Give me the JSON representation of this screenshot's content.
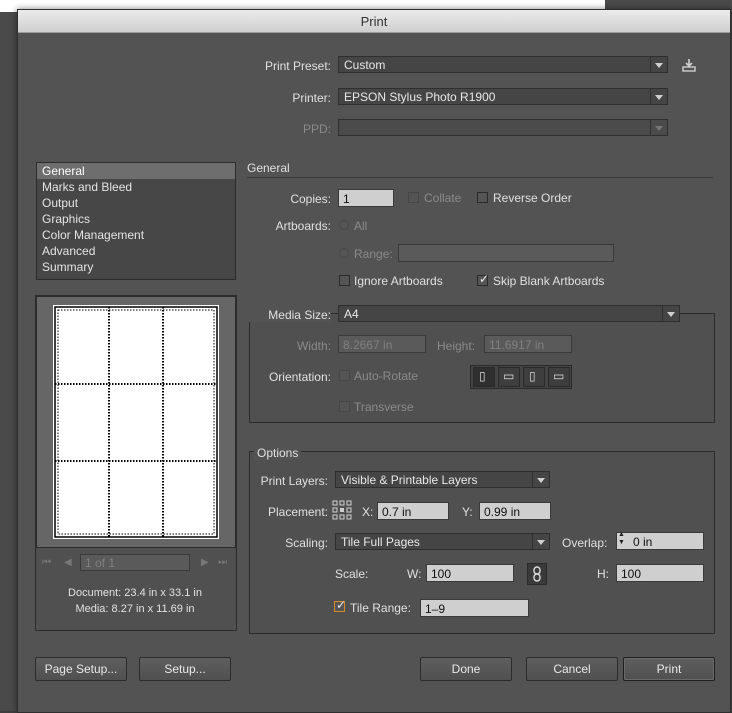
{
  "window": {
    "title": "Print"
  },
  "top": {
    "preset_label": "Print Preset:",
    "preset_value": "Custom",
    "printer_label": "Printer:",
    "printer_value": "EPSON Stylus Photo R1900",
    "ppd_label": "PPD:",
    "ppd_value": ""
  },
  "sidebar": {
    "items": [
      {
        "label": "General",
        "selected": true
      },
      {
        "label": "Marks and Bleed"
      },
      {
        "label": "Output"
      },
      {
        "label": "Graphics"
      },
      {
        "label": "Color Management"
      },
      {
        "label": "Advanced"
      },
      {
        "label": "Summary"
      }
    ]
  },
  "preview": {
    "page_field": "1 of 1",
    "document_info": "Document: 23.4 in x 33.1 in",
    "media_info": "Media: 8.27 in x 11.69 in",
    "tiles_columns": 3,
    "tiles_rows": 3
  },
  "general": {
    "section_title": "General",
    "copies_label": "Copies:",
    "copies_value": "1",
    "collate_label": "Collate",
    "reverse_label": "Reverse Order",
    "artboards_label": "Artboards:",
    "all_label": "All",
    "range_label": "Range:",
    "range_value": "",
    "ignore_label": "Ignore Artboards",
    "skip_label": "Skip Blank Artboards",
    "skip_checked": true
  },
  "media": {
    "size_label": "Media Size:",
    "size_value": "A4",
    "width_label": "Width:",
    "width_value": "8.2667 in",
    "height_label": "Height:",
    "height_value": "11.6917 in",
    "orientation_label": "Orientation:",
    "autorotate_label": "Auto-Rotate",
    "transverse_label": "Transverse"
  },
  "options": {
    "title": "Options",
    "layers_label": "Print Layers:",
    "layers_value": "Visible & Printable Layers",
    "placement_label": "Placement:",
    "x_label": "X:",
    "x_value": "0.7 in",
    "y_label": "Y:",
    "y_value": "0.99 in",
    "scaling_label": "Scaling:",
    "scaling_value": "Tile Full Pages",
    "overlap_label": "Overlap:",
    "overlap_value": "0 in",
    "scale_label": "Scale:",
    "w_label": "W:",
    "w_value": "100",
    "h_label": "H:",
    "h_value": "100",
    "tile_range_label": "Tile Range:",
    "tile_range_value": "1–9",
    "tile_range_checked": true
  },
  "buttons": {
    "page_setup": "Page Setup...",
    "setup": "Setup...",
    "done": "Done",
    "cancel": "Cancel",
    "print": "Print"
  },
  "colors": {
    "accent": "#d48b2c",
    "dialog_bg": "#535353"
  }
}
